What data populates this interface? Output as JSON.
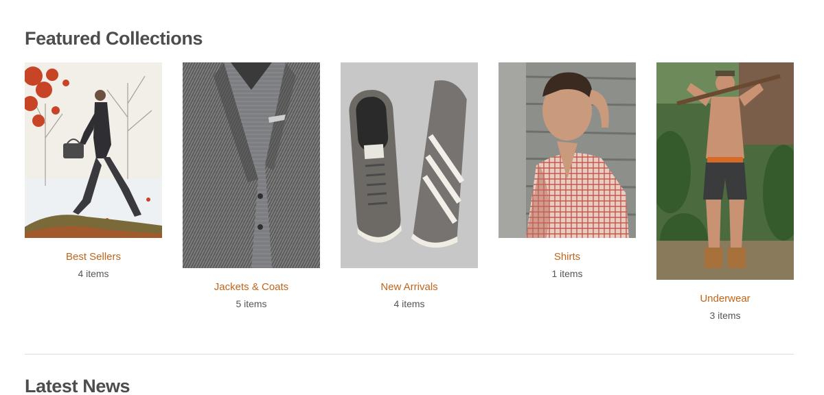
{
  "featured": {
    "title": "Featured Collections",
    "collections": [
      {
        "name": "Best Sellers",
        "count": "4 items"
      },
      {
        "name": "Jackets & Coats",
        "count": "5 items"
      },
      {
        "name": "New Arrivals",
        "count": "4 items"
      },
      {
        "name": "Shirts",
        "count": "1 items"
      },
      {
        "name": "Underwear",
        "count": "3 items"
      }
    ]
  },
  "news": {
    "title": "Latest News"
  },
  "colors": {
    "accent": "#c0641a",
    "text": "#4d4d4d",
    "divider": "#dcdcdc"
  }
}
